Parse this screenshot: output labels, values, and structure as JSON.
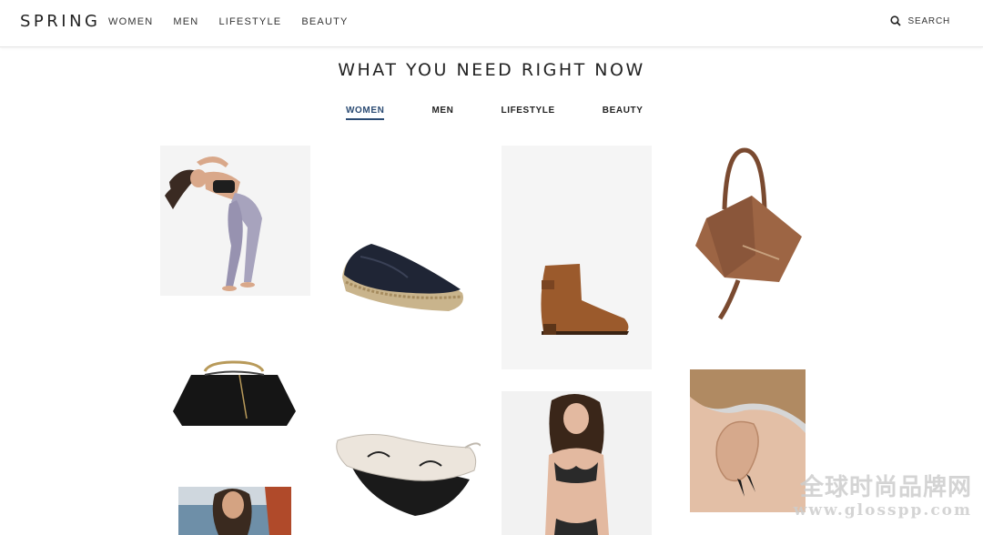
{
  "header": {
    "logo": "SPRING",
    "nav": [
      {
        "label": "WOMEN"
      },
      {
        "label": "MEN"
      },
      {
        "label": "LIFESTYLE"
      },
      {
        "label": "BEAUTY"
      }
    ],
    "search_label": "SEARCH"
  },
  "main": {
    "title": "WHAT YOU NEED RIGHT NOW",
    "tabs": [
      {
        "label": "WOMEN",
        "active": true
      },
      {
        "label": "MEN",
        "active": false
      },
      {
        "label": "LIFESTYLE",
        "active": false
      },
      {
        "label": "BEAUTY",
        "active": false
      }
    ],
    "products": [
      {
        "icon": "yoga-model-image"
      },
      {
        "icon": "espadrille-shoe-image"
      },
      {
        "icon": "ankle-boot-image"
      },
      {
        "icon": "leather-bag-image"
      },
      {
        "icon": "black-clutch-image"
      },
      {
        "icon": "sleep-mask-image"
      },
      {
        "icon": "lingerie-model-image"
      },
      {
        "icon": "ear-cuff-image"
      },
      {
        "icon": "swimwear-model-image"
      }
    ]
  },
  "watermark": {
    "line1": "全球时尚品牌网",
    "line2": "www.glosspp.com"
  },
  "colors": {
    "accent": "#2b4b73",
    "text": "#222222",
    "border": "#e6e6e6"
  }
}
